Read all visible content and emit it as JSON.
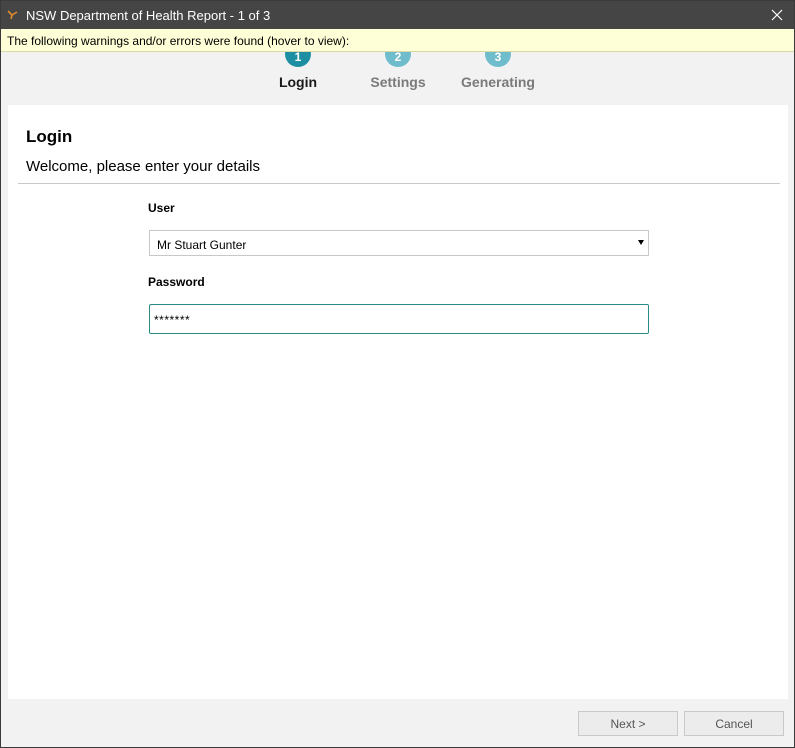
{
  "window": {
    "title": "NSW Department of Health Report - 1 of 3",
    "icon": "app-logo-icon",
    "close_icon": "close-icon"
  },
  "warning_bar": {
    "text": "The following warnings and/or errors were found (hover to view):",
    "background": "#ffffd7"
  },
  "steps": [
    {
      "number": "1",
      "label": "Login",
      "state": "active",
      "color": "#1e8fa3"
    },
    {
      "number": "2",
      "label": "Settings",
      "state": "pending",
      "color": "#6fbdcc"
    },
    {
      "number": "3",
      "label": "Generating",
      "state": "pending",
      "color": "#6fbdcc"
    }
  ],
  "page": {
    "heading": "Login",
    "subtitle": "Welcome, please enter your details"
  },
  "form": {
    "user_label": "User",
    "user_value": "Mr Stuart Gunter",
    "password_label": "Password",
    "password_value": "*******"
  },
  "footer": {
    "next_label": "Next >",
    "cancel_label": "Cancel"
  },
  "colors": {
    "titlebar": "#454545",
    "accent": "#1e8fa3",
    "focus_border": "#2a8a84"
  }
}
